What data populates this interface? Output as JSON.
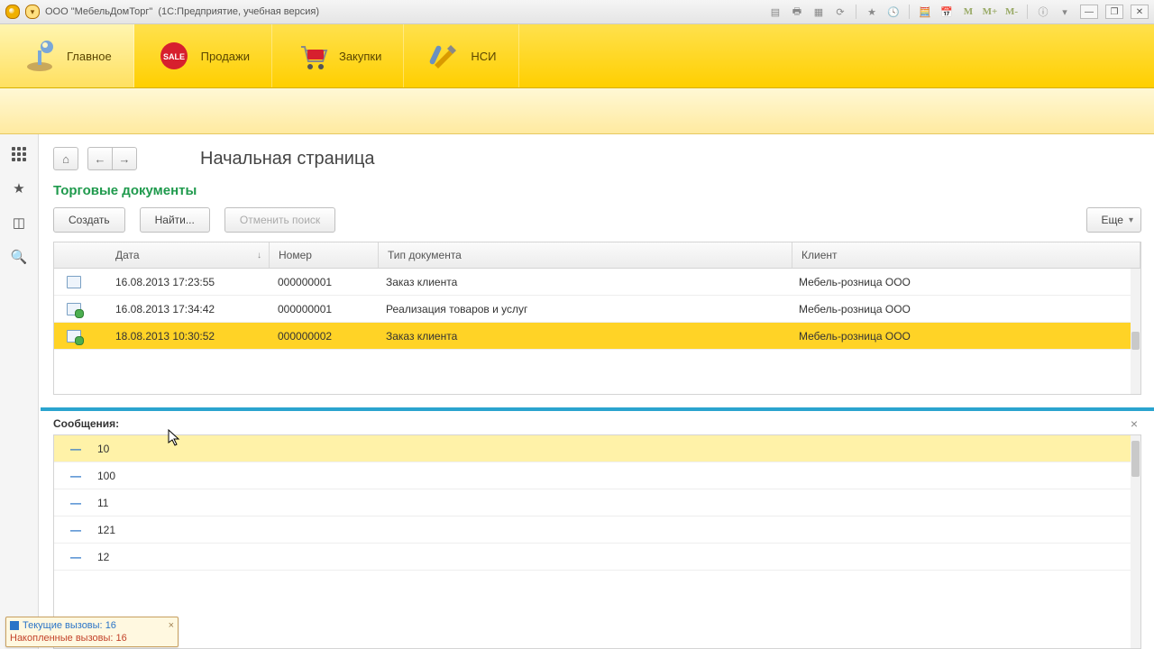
{
  "titlebar": {
    "company": "ООО \"МебельДомТорг\"",
    "suffix": "(1С:Предприятие, учебная версия)",
    "m": "M",
    "mplus": "M+",
    "mminus": "M-"
  },
  "nav": {
    "items": [
      {
        "label": "Главное",
        "icon": "lamp"
      },
      {
        "label": "Продажи",
        "icon": "sale"
      },
      {
        "label": "Закупки",
        "icon": "cart"
      },
      {
        "label": "НСИ",
        "icon": "tools"
      }
    ]
  },
  "page": {
    "title": "Начальная страница"
  },
  "section": {
    "title": "Торговые документы"
  },
  "actions": {
    "create": "Создать",
    "find": "Найти...",
    "cancel": "Отменить поиск",
    "more": "Еще"
  },
  "table": {
    "headers": {
      "date": "Дата",
      "num": "Номер",
      "type": "Тип документа",
      "client": "Клиент"
    },
    "rows": [
      {
        "date": "16.08.2013 17:23:55",
        "num": "000000001",
        "type": "Заказ клиента",
        "client": "Мебель-розница ООО",
        "ok": false,
        "sel": false
      },
      {
        "date": "16.08.2013 17:34:42",
        "num": "000000001",
        "type": "Реализация товаров и услуг",
        "client": "Мебель-розница ООО",
        "ok": true,
        "sel": false
      },
      {
        "date": "18.08.2013 10:30:52",
        "num": "000000002",
        "type": "Заказ клиента",
        "client": "Мебель-розница ООО",
        "ok": true,
        "sel": true
      }
    ]
  },
  "messages": {
    "title": "Сообщения:",
    "items": [
      "10",
      "100",
      "11",
      "121",
      "12"
    ]
  },
  "status": {
    "line1_label": "Текущие вызовы:",
    "line1_val": "16",
    "line2_label": "Накопленные вызовы:",
    "line2_val": "16"
  }
}
